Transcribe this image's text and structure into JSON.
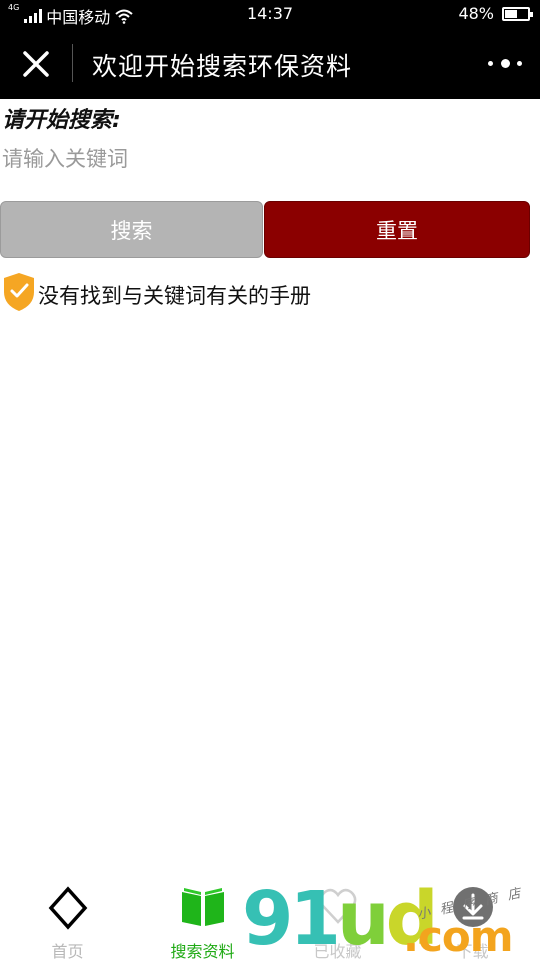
{
  "status_bar": {
    "network_tag": "4G",
    "carrier": "中国移动",
    "time": "14:37",
    "battery_percent_label": "48%",
    "battery_level": 0.48
  },
  "nav": {
    "title": "欢迎开始搜索环保资料"
  },
  "search": {
    "heading": "请开始搜索:",
    "placeholder": "请输入关键词",
    "value": ""
  },
  "buttons": {
    "search_label": "搜索",
    "reset_label": "重置"
  },
  "result": {
    "message": "没有找到与关键词有关的手册"
  },
  "tabs": [
    {
      "label": "首页",
      "icon": "diamond-icon",
      "active": false
    },
    {
      "label": "搜索资料",
      "icon": "open-book-icon",
      "active": true
    },
    {
      "label": "已收藏",
      "icon": "heart-icon",
      "active": false
    },
    {
      "label": "下载",
      "icon": "download-icon",
      "active": false
    }
  ],
  "watermark": {
    "brand": "91ud",
    "suffix": ".com",
    "handwriting": "小程序商店"
  },
  "colors": {
    "nav_background": "#000000",
    "reset_button": "#8b0000",
    "search_button": "#b4b4b4",
    "active_tab": "#1faa14",
    "shield": "#f5a623"
  }
}
